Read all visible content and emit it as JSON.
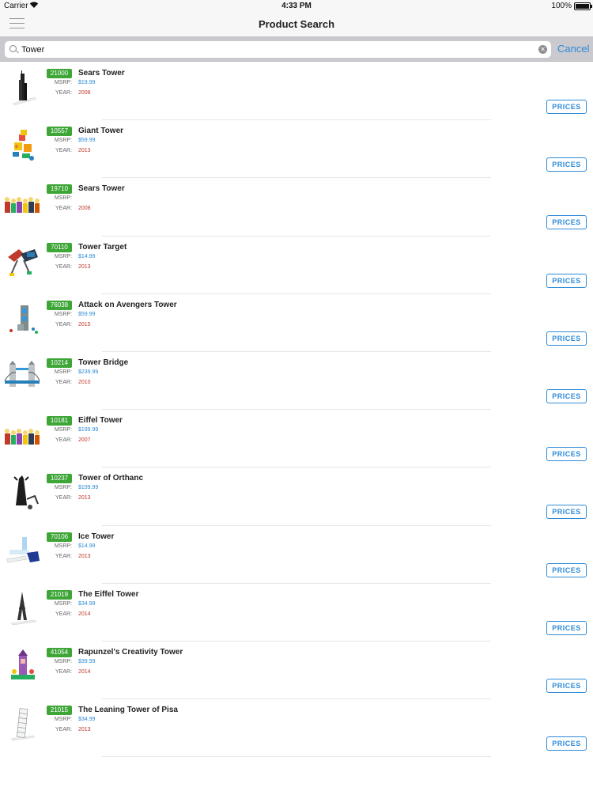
{
  "status": {
    "carrier": "Carrier",
    "time": "4:33 PM",
    "battery": "100%"
  },
  "nav": {
    "title": "Product Search"
  },
  "search": {
    "value": "Tower",
    "cancel": "Cancel"
  },
  "labels": {
    "msrp": "MSRP:",
    "year": "YEAR:",
    "prices": "PRICES"
  },
  "colors": {
    "badge": "#3da637",
    "accent": "#2f8bd8",
    "year": "#c0392b"
  },
  "results": [
    {
      "id": "21000",
      "name": "Sears Tower",
      "msrp": "$19.99",
      "year": "2008",
      "thumb": "tall-tower"
    },
    {
      "id": "10557",
      "name": "Giant Tower",
      "msrp": "$59.99",
      "year": "2013",
      "thumb": "duplo"
    },
    {
      "id": "19710",
      "name": "Sears Tower",
      "msrp": "",
      "year": "2008",
      "thumb": "minifigs"
    },
    {
      "id": "70110",
      "name": "Tower Target",
      "msrp": "$14.99",
      "year": "2013",
      "thumb": "chima"
    },
    {
      "id": "76038",
      "name": "Attack on Avengers Tower",
      "msrp": "$59.99",
      "year": "2015",
      "thumb": "avengers"
    },
    {
      "id": "10214",
      "name": "Tower Bridge",
      "msrp": "$239.99",
      "year": "2010",
      "thumb": "bridge"
    },
    {
      "id": "10181",
      "name": "Eiffel Tower",
      "msrp": "$199.99",
      "year": "2007",
      "thumb": "minifigs"
    },
    {
      "id": "10237",
      "name": "Tower of Orthanc",
      "msrp": "$199.99",
      "year": "2013",
      "thumb": "dark-tower"
    },
    {
      "id": "70106",
      "name": "Ice Tower",
      "msrp": "$14.99",
      "year": "2013",
      "thumb": "ice"
    },
    {
      "id": "21019",
      "name": "The Eiffel Tower",
      "msrp": "$34.99",
      "year": "2014",
      "thumb": "eiffel"
    },
    {
      "id": "41054",
      "name": "Rapunzel's Creativity Tower",
      "msrp": "$39.99",
      "year": "2014",
      "thumb": "castle"
    },
    {
      "id": "21015",
      "name": "The Leaning Tower of Pisa",
      "msrp": "$34.99",
      "year": "2013",
      "thumb": "pisa"
    }
  ]
}
